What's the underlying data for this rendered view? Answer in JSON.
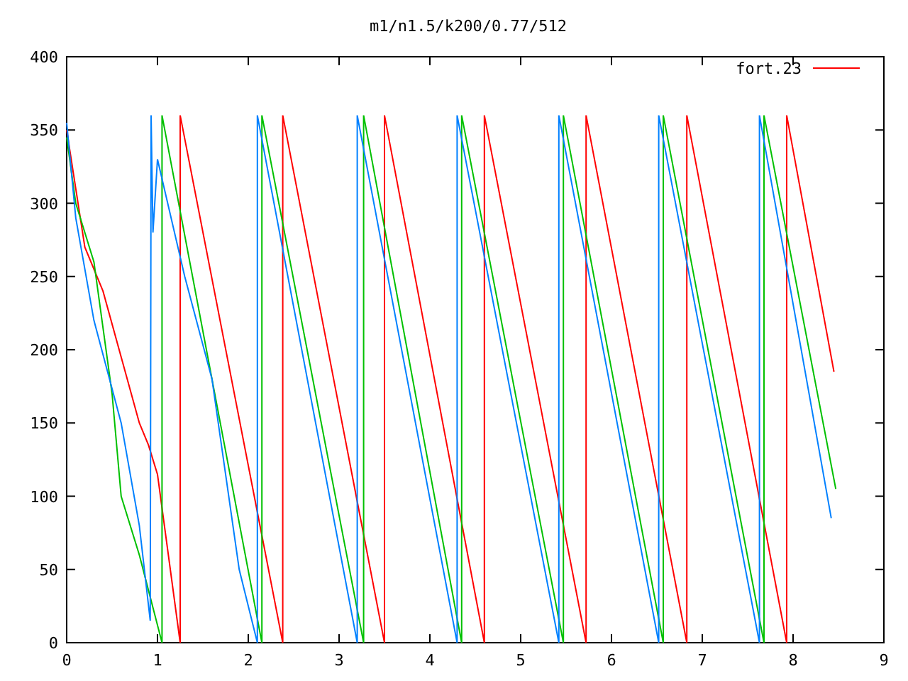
{
  "chart_data": {
    "type": "line",
    "title": "m1/n1.5/k200/0.77/512",
    "xlim": [
      0,
      9
    ],
    "ylim": [
      0,
      400
    ],
    "xticks": [
      0,
      1,
      2,
      3,
      4,
      5,
      6,
      7,
      8,
      9
    ],
    "yticks": [
      0,
      50,
      100,
      150,
      200,
      250,
      300,
      350,
      400
    ],
    "series": [
      {
        "name": "fort.23",
        "color": "#ff0000",
        "x": [
          0,
          0.05,
          0.1,
          0.2,
          0.4,
          0.8,
          0.9,
          1.0,
          1.25,
          1.25,
          2.38,
          2.38,
          3.5,
          3.5,
          4.6,
          4.6,
          5.72,
          5.72,
          6.83,
          6.83,
          7.93,
          7.93,
          8.45
        ],
        "values": [
          350,
          330,
          310,
          270,
          240,
          150,
          135,
          115,
          0,
          360,
          0,
          360,
          0,
          360,
          0,
          360,
          0,
          360,
          0,
          360,
          0,
          360,
          185
        ]
      },
      {
        "color": "#00c000",
        "x": [
          0,
          0.1,
          0.3,
          0.5,
          0.6,
          0.8,
          1.05,
          1.05,
          2.15,
          2.15,
          3.27,
          3.27,
          4.35,
          4.35,
          5.47,
          5.47,
          6.57,
          6.57,
          7.68,
          7.68,
          8.47
        ],
        "values": [
          345,
          300,
          260,
          170,
          100,
          60,
          0,
          360,
          0,
          360,
          0,
          360,
          0,
          360,
          0,
          360,
          0,
          360,
          0,
          360,
          105
        ]
      },
      {
        "color": "#0080ff",
        "x": [
          0,
          0.1,
          0.3,
          0.6,
          0.8,
          0.92,
          0.93,
          0.95,
          1.0,
          1.3,
          1.6,
          1.9,
          2.1,
          2.1,
          3.2,
          3.2,
          4.3,
          4.3,
          5.42,
          5.42,
          6.52,
          6.52,
          7.63,
          7.63,
          8.42
        ],
        "values": [
          355,
          290,
          220,
          150,
          80,
          15,
          360,
          280,
          330,
          250,
          180,
          50,
          0,
          360,
          0,
          360,
          0,
          360,
          0,
          360,
          0,
          360,
          0,
          360,
          85
        ]
      }
    ]
  }
}
